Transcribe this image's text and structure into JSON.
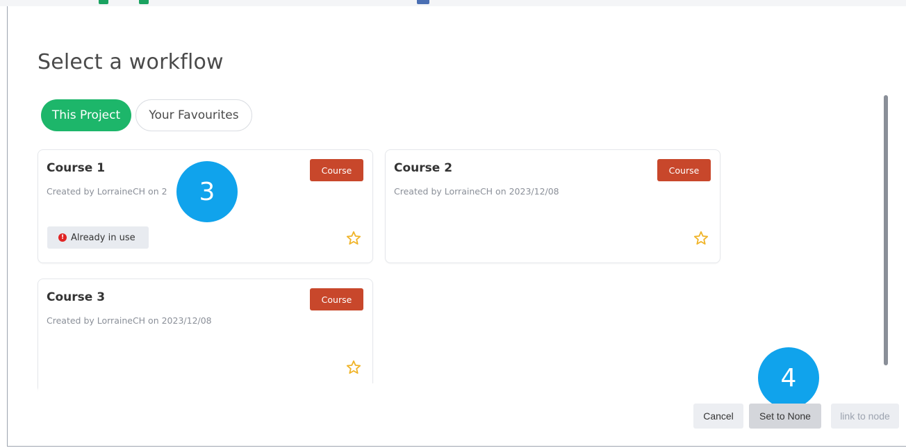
{
  "dialog": {
    "title": "Select a workflow"
  },
  "tabs": [
    {
      "label": "This Project",
      "active": true
    },
    {
      "label": "Your Favourites",
      "active": false
    }
  ],
  "workflows": [
    {
      "name": "Course 1",
      "meta": "Created by LorraineCH on 2",
      "type": "Course",
      "status": "Already in use",
      "favorite": false
    },
    {
      "name": "Course 2",
      "meta": "Created by LorraineCH on 2023/12/08",
      "type": "Course",
      "status": "",
      "favorite": false
    },
    {
      "name": "Course 3",
      "meta": "Created by LorraineCH on 2023/12/08",
      "type": "Course",
      "status": "",
      "favorite": false
    }
  ],
  "markers": {
    "step3": "3",
    "step4": "4"
  },
  "footer": {
    "cancel_label": "Cancel",
    "set_none_label": "Set to None",
    "link_label": "link to node"
  },
  "colors": {
    "tab_active": "#1db66a",
    "badge": "#c8472b",
    "marker": "#10a3ec",
    "star": "#f0b429",
    "alert": "#e02424"
  }
}
